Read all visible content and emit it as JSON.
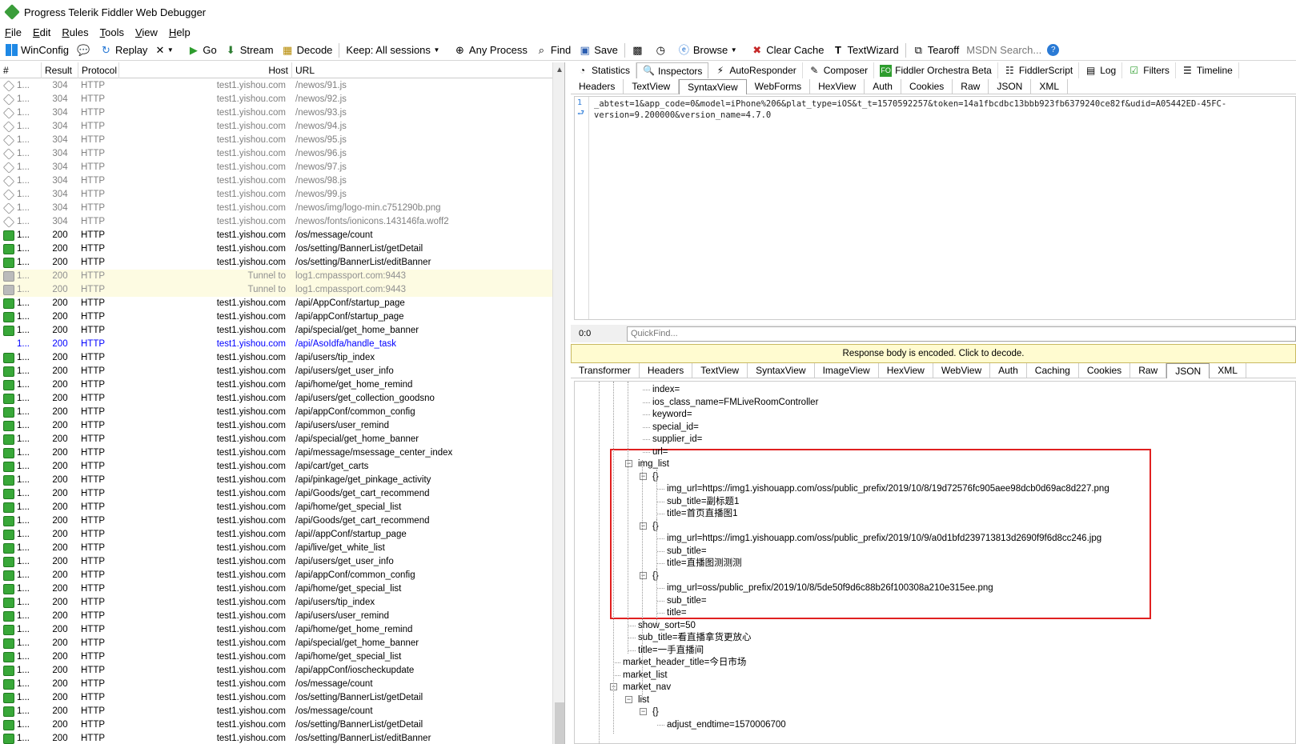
{
  "app": {
    "title": "Progress Telerik Fiddler Web Debugger"
  },
  "menu": [
    "File",
    "Edit",
    "Rules",
    "Tools",
    "View",
    "Help"
  ],
  "toolbar": {
    "winconfig": "WinConfig",
    "replay": "Replay",
    "remove": "✕",
    "go": "Go",
    "stream": "Stream",
    "decode": "Decode",
    "keep": "Keep: All sessions",
    "process": "Any Process",
    "find": "Find",
    "save": "Save",
    "browse": "Browse",
    "clear_cache": "Clear Cache",
    "textwizard": "TextWizard",
    "tearoff": "Tearoff",
    "search_placeholder": "MSDN Search..."
  },
  "grid": {
    "columns": [
      "#",
      "Result",
      "Protocol",
      "Host",
      "URL"
    ],
    "rows": [
      {
        "n": "1...",
        "r": "304",
        "p": "HTTP",
        "h": "test1.yishou.com",
        "u": "/newos/91.js",
        "t": "gray"
      },
      {
        "n": "1...",
        "r": "304",
        "p": "HTTP",
        "h": "test1.yishou.com",
        "u": "/newos/92.js",
        "t": "gray"
      },
      {
        "n": "1...",
        "r": "304",
        "p": "HTTP",
        "h": "test1.yishou.com",
        "u": "/newos/93.js",
        "t": "gray"
      },
      {
        "n": "1...",
        "r": "304",
        "p": "HTTP",
        "h": "test1.yishou.com",
        "u": "/newos/94.js",
        "t": "gray"
      },
      {
        "n": "1...",
        "r": "304",
        "p": "HTTP",
        "h": "test1.yishou.com",
        "u": "/newos/95.js",
        "t": "gray"
      },
      {
        "n": "1...",
        "r": "304",
        "p": "HTTP",
        "h": "test1.yishou.com",
        "u": "/newos/96.js",
        "t": "gray"
      },
      {
        "n": "1...",
        "r": "304",
        "p": "HTTP",
        "h": "test1.yishou.com",
        "u": "/newos/97.js",
        "t": "gray"
      },
      {
        "n": "1...",
        "r": "304",
        "p": "HTTP",
        "h": "test1.yishou.com",
        "u": "/newos/98.js",
        "t": "gray"
      },
      {
        "n": "1...",
        "r": "304",
        "p": "HTTP",
        "h": "test1.yishou.com",
        "u": "/newos/99.js",
        "t": "gray"
      },
      {
        "n": "1...",
        "r": "304",
        "p": "HTTP",
        "h": "test1.yishou.com",
        "u": "/newos/img/logo-min.c751290b.png",
        "t": "gray"
      },
      {
        "n": "1...",
        "r": "304",
        "p": "HTTP",
        "h": "test1.yishou.com",
        "u": "/newos/fonts/ionicons.143146fa.woff2",
        "t": "gray"
      },
      {
        "n": "1...",
        "r": "200",
        "p": "HTTP",
        "h": "test1.yishou.com",
        "u": "/os/message/count",
        "t": "ok"
      },
      {
        "n": "1...",
        "r": "200",
        "p": "HTTP",
        "h": "test1.yishou.com",
        "u": "/os/setting/BannerList/getDetail",
        "t": "ok"
      },
      {
        "n": "1...",
        "r": "200",
        "p": "HTTP",
        "h": "test1.yishou.com",
        "u": "/os/setting/BannerList/editBanner",
        "t": "ok"
      },
      {
        "n": "1...",
        "r": "200",
        "p": "HTTP",
        "h": "Tunnel to",
        "u": "log1.cmpassport.com:9443",
        "t": "tunnel"
      },
      {
        "n": "1...",
        "r": "200",
        "p": "HTTP",
        "h": "Tunnel to",
        "u": "log1.cmpassport.com:9443",
        "t": "tunnel"
      },
      {
        "n": "1...",
        "r": "200",
        "p": "HTTP",
        "h": "test1.yishou.com",
        "u": "/api/AppConf/startup_page",
        "t": "ok"
      },
      {
        "n": "1...",
        "r": "200",
        "p": "HTTP",
        "h": "test1.yishou.com",
        "u": "/api/appConf/startup_page",
        "t": "ok"
      },
      {
        "n": "1...",
        "r": "200",
        "p": "HTTP",
        "h": "test1.yishou.com",
        "u": "/api/special/get_home_banner",
        "t": "ok"
      },
      {
        "n": "1...",
        "r": "200",
        "p": "HTTP",
        "h": "test1.yishou.com",
        "u": "/api/AsoIdfa/handle_task",
        "t": "sel"
      },
      {
        "n": "1...",
        "r": "200",
        "p": "HTTP",
        "h": "test1.yishou.com",
        "u": "/api/users/tip_index",
        "t": "ok"
      },
      {
        "n": "1...",
        "r": "200",
        "p": "HTTP",
        "h": "test1.yishou.com",
        "u": "/api/users/get_user_info",
        "t": "ok"
      },
      {
        "n": "1...",
        "r": "200",
        "p": "HTTP",
        "h": "test1.yishou.com",
        "u": "/api/home/get_home_remind",
        "t": "ok"
      },
      {
        "n": "1...",
        "r": "200",
        "p": "HTTP",
        "h": "test1.yishou.com",
        "u": "/api/users/get_collection_goodsno",
        "t": "ok"
      },
      {
        "n": "1...",
        "r": "200",
        "p": "HTTP",
        "h": "test1.yishou.com",
        "u": "/api/appConf/common_config",
        "t": "ok"
      },
      {
        "n": "1...",
        "r": "200",
        "p": "HTTP",
        "h": "test1.yishou.com",
        "u": "/api/users/user_remind",
        "t": "ok"
      },
      {
        "n": "1...",
        "r": "200",
        "p": "HTTP",
        "h": "test1.yishou.com",
        "u": "/api/special/get_home_banner",
        "t": "ok"
      },
      {
        "n": "1...",
        "r": "200",
        "p": "HTTP",
        "h": "test1.yishou.com",
        "u": "/api/message/msessage_center_index",
        "t": "ok"
      },
      {
        "n": "1...",
        "r": "200",
        "p": "HTTP",
        "h": "test1.yishou.com",
        "u": "/api/cart/get_carts",
        "t": "ok"
      },
      {
        "n": "1...",
        "r": "200",
        "p": "HTTP",
        "h": "test1.yishou.com",
        "u": "/api/pinkage/get_pinkage_activity",
        "t": "ok"
      },
      {
        "n": "1...",
        "r": "200",
        "p": "HTTP",
        "h": "test1.yishou.com",
        "u": "/api/Goods/get_cart_recommend",
        "t": "ok"
      },
      {
        "n": "1...",
        "r": "200",
        "p": "HTTP",
        "h": "test1.yishou.com",
        "u": "/api/home/get_special_list",
        "t": "ok"
      },
      {
        "n": "1...",
        "r": "200",
        "p": "HTTP",
        "h": "test1.yishou.com",
        "u": "/api/Goods/get_cart_recommend",
        "t": "ok"
      },
      {
        "n": "1...",
        "r": "200",
        "p": "HTTP",
        "h": "test1.yishou.com",
        "u": "/api//appConf/startup_page",
        "t": "ok"
      },
      {
        "n": "1...",
        "r": "200",
        "p": "HTTP",
        "h": "test1.yishou.com",
        "u": "/api/live/get_white_list",
        "t": "ok"
      },
      {
        "n": "1...",
        "r": "200",
        "p": "HTTP",
        "h": "test1.yishou.com",
        "u": "/api/users/get_user_info",
        "t": "ok"
      },
      {
        "n": "1...",
        "r": "200",
        "p": "HTTP",
        "h": "test1.yishou.com",
        "u": "/api/appConf/common_config",
        "t": "ok"
      },
      {
        "n": "1...",
        "r": "200",
        "p": "HTTP",
        "h": "test1.yishou.com",
        "u": "/api/home/get_special_list",
        "t": "ok"
      },
      {
        "n": "1...",
        "r": "200",
        "p": "HTTP",
        "h": "test1.yishou.com",
        "u": "/api/users/tip_index",
        "t": "ok"
      },
      {
        "n": "1...",
        "r": "200",
        "p": "HTTP",
        "h": "test1.yishou.com",
        "u": "/api/users/user_remind",
        "t": "ok"
      },
      {
        "n": "1...",
        "r": "200",
        "p": "HTTP",
        "h": "test1.yishou.com",
        "u": "/api/home/get_home_remind",
        "t": "ok"
      },
      {
        "n": "1...",
        "r": "200",
        "p": "HTTP",
        "h": "test1.yishou.com",
        "u": "/api/special/get_home_banner",
        "t": "ok"
      },
      {
        "n": "1...",
        "r": "200",
        "p": "HTTP",
        "h": "test1.yishou.com",
        "u": "/api/home/get_special_list",
        "t": "ok"
      },
      {
        "n": "1...",
        "r": "200",
        "p": "HTTP",
        "h": "test1.yishou.com",
        "u": "/api/appConf/ioscheckupdate",
        "t": "ok"
      },
      {
        "n": "1...",
        "r": "200",
        "p": "HTTP",
        "h": "test1.yishou.com",
        "u": "/os/message/count",
        "t": "ok"
      },
      {
        "n": "1...",
        "r": "200",
        "p": "HTTP",
        "h": "test1.yishou.com",
        "u": "/os/setting/BannerList/getDetail",
        "t": "ok"
      },
      {
        "n": "1...",
        "r": "200",
        "p": "HTTP",
        "h": "test1.yishou.com",
        "u": "/os/message/count",
        "t": "ok"
      },
      {
        "n": "1...",
        "r": "200",
        "p": "HTTP",
        "h": "test1.yishou.com",
        "u": "/os/setting/BannerList/getDetail",
        "t": "ok"
      },
      {
        "n": "1...",
        "r": "200",
        "p": "HTTP",
        "h": "test1.yishou.com",
        "u": "/os/setting/BannerList/editBanner",
        "t": "ok"
      }
    ]
  },
  "top_tabs": [
    "Statistics",
    "Inspectors",
    "AutoResponder",
    "Composer",
    "Fiddler Orchestra Beta",
    "FiddlerScript",
    "Log",
    "Filters",
    "Timeline"
  ],
  "request_tabs": [
    "Headers",
    "TextView",
    "SyntaxView",
    "WebForms",
    "HexView",
    "Auth",
    "Cookies",
    "Raw",
    "JSON",
    "XML"
  ],
  "request_body": {
    "line_number": "1",
    "wrap_mark": "⮐",
    "line1": "_abtest=1&app_code=0&model=iPhone%206&plat_type=iOS&t_t=1570592257&token=14a1fbcdbc13bbb923fb6379240ce82f&udid=A05442ED-45FC-",
    "line2": "version=9.200000&version_name=4.7.0"
  },
  "quickfind": {
    "position": "0:0",
    "placeholder": "QuickFind..."
  },
  "notice": "Response body is encoded. Click to decode.",
  "response_tabs": [
    "Transformer",
    "Headers",
    "TextView",
    "SyntaxView",
    "ImageView",
    "HexView",
    "WebView",
    "Auth",
    "Caching",
    "Cookies",
    "Raw",
    "JSON",
    "XML"
  ],
  "tree": [
    "index=",
    "ios_class_name=FMLiveRoomController",
    "keyword=",
    "special_id=",
    "supplier_id=",
    "url=",
    "img_list",
    "{}",
    "img_url=https://img1.yishouapp.com/oss/public_prefix/2019/10/8/19d72576fc905aee98dcb0d69ac8d227.png",
    "sub_title=副标题1",
    "title=首页直播图1",
    "{}",
    "img_url=https://img1.yishouapp.com/oss/public_prefix/2019/10/9/a0d1bfd239713813d2690f9f6d8cc246.jpg",
    "sub_title=",
    "title=直播图测测测",
    "{}",
    "img_url=oss/public_prefix/2019/10/8/5de50f9d6c88b26f100308a210e315ee.png",
    "sub_title=",
    "title=",
    "show_sort=50",
    "sub_title=看直播拿货更放心",
    "title=一手直播间",
    "market_header_title=今日市场",
    "market_list",
    "market_nav",
    "list",
    "{}",
    "adjust_endtime=1570006700"
  ]
}
